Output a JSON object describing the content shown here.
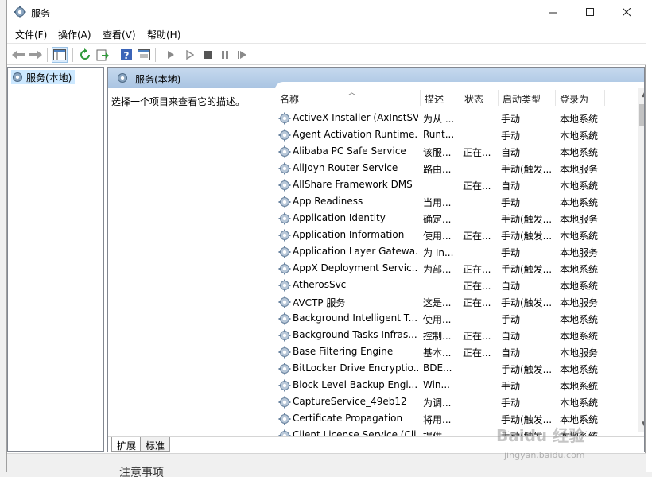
{
  "window": {
    "title": "服务"
  },
  "titlebar": {
    "min_label": "—",
    "max_label": "☐",
    "close_label": "✕"
  },
  "menu": [
    "文件(F)",
    "操作(A)",
    "查看(V)",
    "帮助(H)"
  ],
  "tree": {
    "item": "服务(本地)"
  },
  "panel": {
    "header": "服务(本地)",
    "description_hint": "选择一个项目来查看它的描述。"
  },
  "columns": {
    "name": "名称",
    "desc": "描述",
    "status": "状态",
    "startup": "启动类型",
    "logon": "登录为"
  },
  "services": [
    {
      "name": "ActiveX Installer (AxInstSV)",
      "desc": "为从 ...",
      "status": "",
      "startup": "手动",
      "logon": "本地系统"
    },
    {
      "name": "Agent Activation Runtime...",
      "desc": "Runt...",
      "status": "",
      "startup": "手动",
      "logon": "本地系统"
    },
    {
      "name": "Alibaba PC Safe Service",
      "desc": "该服...",
      "status": "正在...",
      "startup": "自动",
      "logon": "本地系统"
    },
    {
      "name": "AllJoyn Router Service",
      "desc": "路由...",
      "status": "",
      "startup": "手动(触发...",
      "logon": "本地服务"
    },
    {
      "name": "AllShare Framework DMS",
      "desc": "",
      "status": "正在...",
      "startup": "自动",
      "logon": "本地系统"
    },
    {
      "name": "App Readiness",
      "desc": "当用...",
      "status": "",
      "startup": "手动",
      "logon": "本地系统"
    },
    {
      "name": "Application Identity",
      "desc": "确定...",
      "status": "",
      "startup": "手动(触发...",
      "logon": "本地服务"
    },
    {
      "name": "Application Information",
      "desc": "使用...",
      "status": "正在...",
      "startup": "手动(触发...",
      "logon": "本地系统"
    },
    {
      "name": "Application Layer Gatewa...",
      "desc": "为 In...",
      "status": "",
      "startup": "手动",
      "logon": "本地服务"
    },
    {
      "name": "AppX Deployment Servic...",
      "desc": "为部...",
      "status": "正在...",
      "startup": "手动(触发...",
      "logon": "本地系统"
    },
    {
      "name": "AtherosSvc",
      "desc": "",
      "status": "正在...",
      "startup": "自动",
      "logon": "本地系统"
    },
    {
      "name": "AVCTP 服务",
      "desc": "这是...",
      "status": "正在...",
      "startup": "手动(触发...",
      "logon": "本地服务"
    },
    {
      "name": "Background Intelligent T...",
      "desc": "使用...",
      "status": "",
      "startup": "手动",
      "logon": "本地系统"
    },
    {
      "name": "Background Tasks Infras...",
      "desc": "控制...",
      "status": "正在...",
      "startup": "自动",
      "logon": "本地系统"
    },
    {
      "name": "Base Filtering Engine",
      "desc": "基本...",
      "status": "正在...",
      "startup": "自动",
      "logon": "本地服务"
    },
    {
      "name": "BitLocker Drive Encryptio...",
      "desc": "BDE...",
      "status": "",
      "startup": "手动(触发...",
      "logon": "本地系统"
    },
    {
      "name": "Block Level Backup Engi...",
      "desc": "Win...",
      "status": "",
      "startup": "手动",
      "logon": "本地系统"
    },
    {
      "name": "CaptureService_49eb12",
      "desc": "为调...",
      "status": "",
      "startup": "手动",
      "logon": "本地系统"
    },
    {
      "name": "Certificate Propagation",
      "desc": "将用...",
      "status": "",
      "startup": "手动(触发...",
      "logon": "本地系统"
    },
    {
      "name": "Client License Service (Cli...",
      "desc": "提供...",
      "status": "",
      "startup": "手动(触发...",
      "logon": "本地系统"
    }
  ],
  "tabs": [
    "扩展",
    "标准"
  ],
  "watermark": {
    "brand": "Baidu 经验",
    "url": "jingyan.baidu.com"
  },
  "bleed": {
    "text": "注意事项"
  }
}
